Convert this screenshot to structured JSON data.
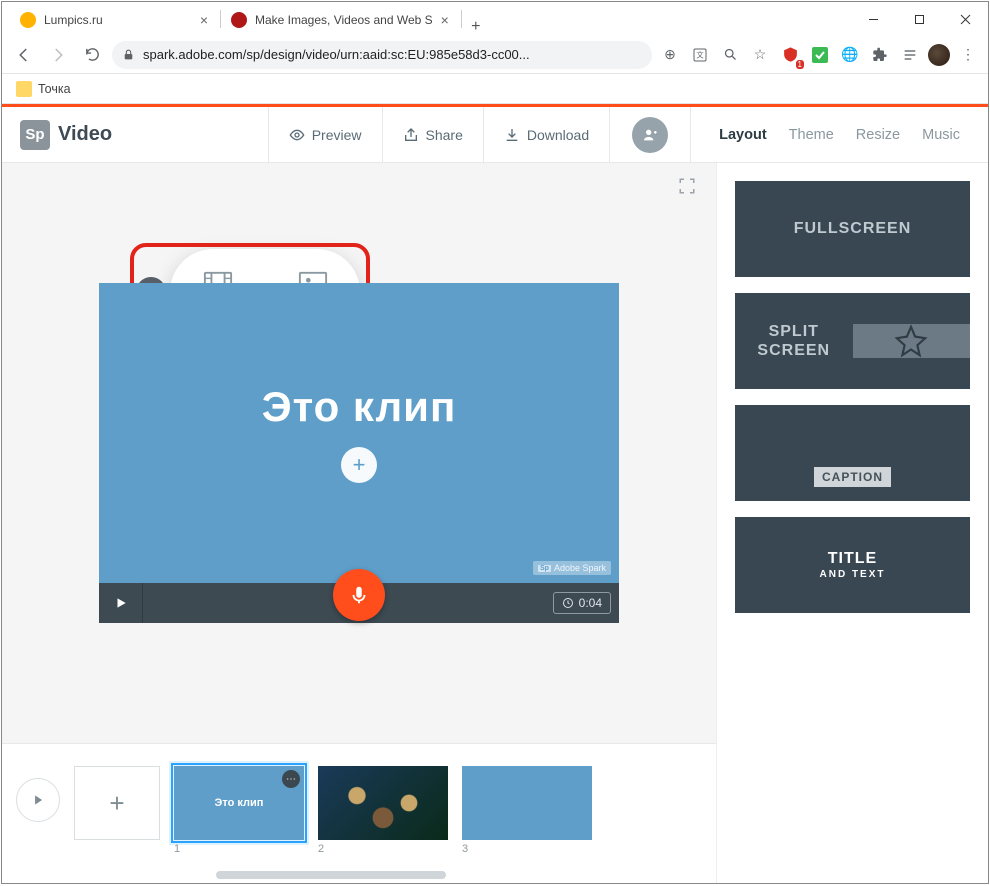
{
  "browser": {
    "tabs": [
      {
        "title": "Lumpics.ru",
        "favicon": "#ffb300"
      },
      {
        "title": "Make Images, Videos and Web S",
        "favicon": "#b01818"
      }
    ],
    "url": "spark.adobe.com/sp/design/video/urn:aaid:sc:EU:985e58d3-cc00...",
    "bookmark": "Точка"
  },
  "app": {
    "brand_logo": "Sp",
    "brand_name": "Video",
    "header_buttons": {
      "preview": "Preview",
      "share": "Share",
      "download": "Download"
    },
    "tabs": {
      "layout": "Layout",
      "theme": "Theme",
      "resize": "Resize",
      "music": "Music"
    }
  },
  "popover": {
    "video": "Video",
    "photo": "Photo"
  },
  "slide": {
    "title": "Это клип",
    "watermark": "Adobe Spark",
    "watermark_logo": "Sp",
    "duration": "0:04"
  },
  "layouts": {
    "fullscreen": "FULLSCREEN",
    "split": "SPLIT SCREEN",
    "caption": "CAPTION",
    "title": "TITLE",
    "title_sub": "AND TEXT"
  },
  "timeline": {
    "thumbs": [
      {
        "n": "1",
        "label": "Это клип"
      },
      {
        "n": "2",
        "label": ""
      },
      {
        "n": "3",
        "label": ""
      }
    ]
  }
}
